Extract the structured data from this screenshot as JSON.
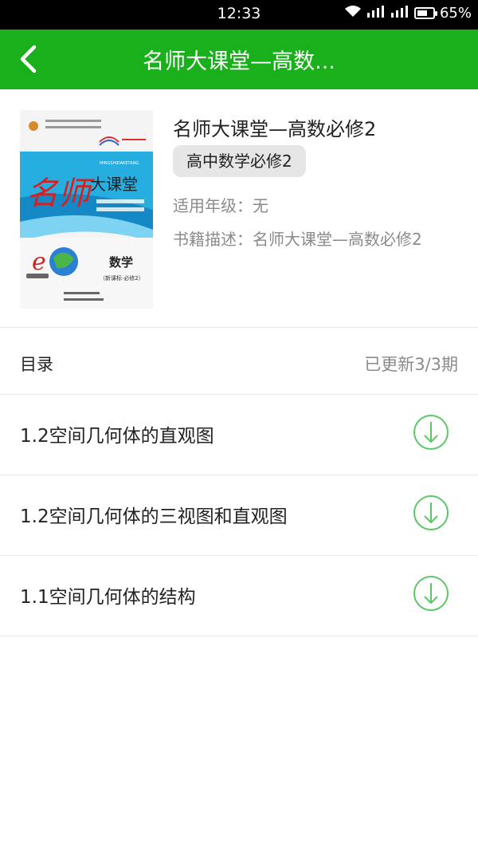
{
  "status_bar": {
    "time": "12:33",
    "battery_percent": "65%",
    "battery_level": 0.65,
    "icons": [
      "wifi-icon",
      "signal-icon",
      "signal-icon",
      "battery-icon"
    ]
  },
  "header": {
    "title": "名师大课堂—高数...",
    "back_icon": "chevron-left-icon",
    "background": "#1ab01c"
  },
  "book": {
    "cover_title_main": "名师",
    "cover_title_sub": "大课堂",
    "cover_pinyin": "MINGSHIDAKETANG",
    "cover_subject": "数学",
    "cover_edition": "（新课标·必修2）",
    "title": "名师大课堂—高数必修2",
    "tag": "高中数学必修2",
    "grade": "适用年级：无",
    "description": "书籍描述：名师大课堂—高数必修2"
  },
  "catalog": {
    "title": "目录",
    "status": "已更新3/3期",
    "accent": "#5bc865",
    "items": [
      {
        "title": "1.2空间几何体的直观图",
        "icon": "download-icon"
      },
      {
        "title": "1.2空间几何体的三视图和直观图",
        "icon": "download-icon"
      },
      {
        "title": "1.1空间几何体的结构",
        "icon": "download-icon"
      }
    ]
  }
}
